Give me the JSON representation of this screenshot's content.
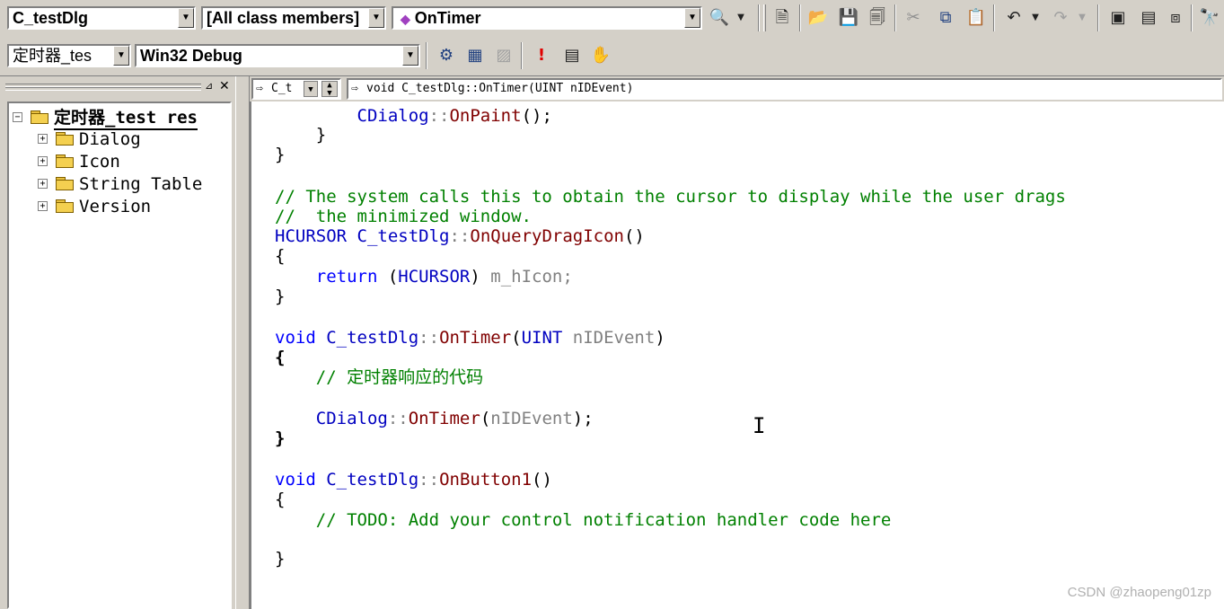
{
  "toolbar1": {
    "class_combo": "C_testDlg",
    "filter_combo": "[All class members]",
    "member_combo": "OnTimer",
    "icons": [
      "wizard-search-icon",
      "new-text-file-icon",
      "open-folder-icon",
      "save-icon",
      "save-all-icon",
      "cut-icon",
      "copy-icon",
      "paste-icon",
      "undo-icon",
      "redo-icon",
      "workspace-icon",
      "output-icon",
      "window-list-icon",
      "find-in-files-icon"
    ]
  },
  "toolbar2": {
    "project_combo": "定时器_tes",
    "config_combo": "Win32 Debug",
    "icons": [
      "compile-icon",
      "build-icon",
      "stop-build-icon",
      "execute-icon",
      "go-icon",
      "insert-breakpoint-icon"
    ]
  },
  "workspace": {
    "root_label": "定时器_test res",
    "items": [
      {
        "label": "Dialog"
      },
      {
        "label": "Icon"
      },
      {
        "label": "String Table"
      },
      {
        "label": "Version"
      }
    ]
  },
  "wizardbar": {
    "scope_combo": "C_t",
    "function_combo": "void C_testDlg::OnTimer(UINT nIDEvent)"
  },
  "code": {
    "l1_class": "CDialog",
    "l1_sep": "::",
    "l1_fn": "OnPaint",
    "l1_tail": "();",
    "l2": "}",
    "l3": "}",
    "l4": "// The system calls this to obtain the cursor to display while the user drags",
    "l5": "//  the minimized window.",
    "l6_type": "HCURSOR",
    "l6_class": "C_testDlg",
    "l6_sep": "::",
    "l6_fn": "OnQueryDragIcon",
    "l6_tail": "()",
    "l7": "{",
    "l8_kw": "return",
    "l8_open": " (",
    "l8_type": "HCURSOR",
    "l8_close": ") ",
    "l8_var": "m_hIcon;",
    "l9": "}",
    "l10_kw": "void",
    "l10_class": "C_testDlg",
    "l10_sep": "::",
    "l10_fn": "OnTimer",
    "l10_open": "(",
    "l10_type": "UINT",
    "l10_arg": " nIDEvent",
    "l10_close": ")",
    "l11": "{",
    "l12": "// 定时器响应的代码",
    "l13_class": "CDialog",
    "l13_sep": "::",
    "l13_fn": "OnTimer",
    "l13_open": "(",
    "l13_arg": "nIDEvent",
    "l13_close": ");",
    "l14": "}",
    "l15_kw": "void",
    "l15_class": "C_testDlg",
    "l15_sep": "::",
    "l15_fn": "OnButton1",
    "l15_tail": "()",
    "l16": "{",
    "l17": "// TODO: Add your control notification handler code here",
    "l18": "}"
  },
  "watermark": "CSDN @zhaopeng01zp"
}
